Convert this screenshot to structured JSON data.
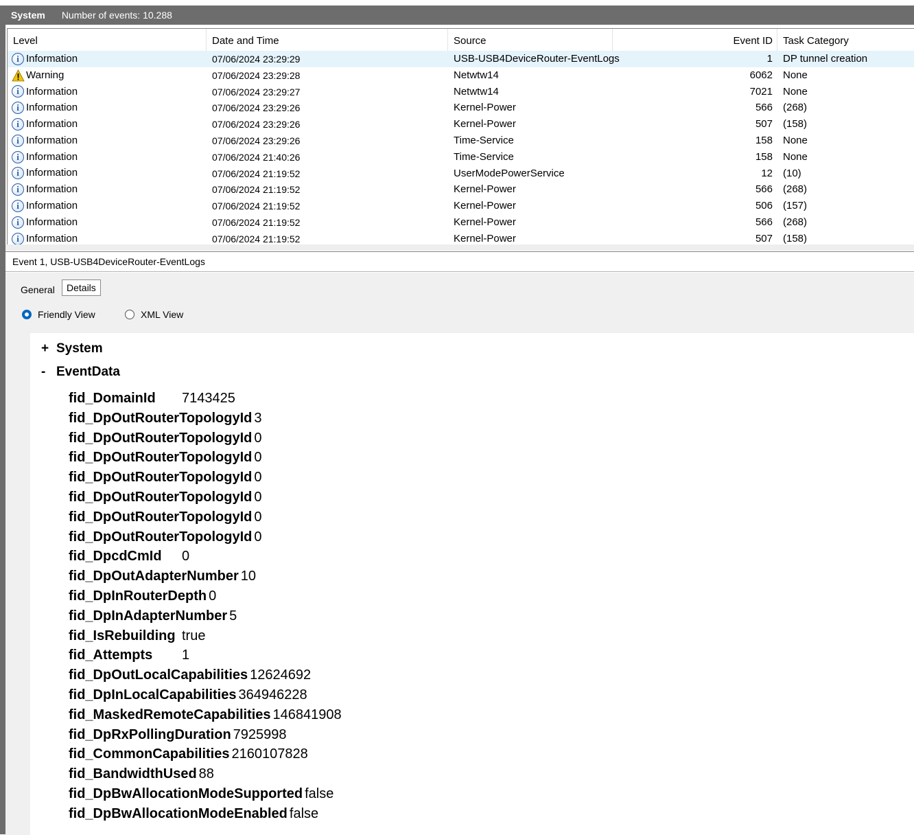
{
  "header": {
    "log_name": "System",
    "event_count": "Number of events: 10.288"
  },
  "columns": [
    "Level",
    "Date and Time",
    "Source",
    "Event ID",
    "Task Category"
  ],
  "events": [
    {
      "level": "Information",
      "icon": "info-icon",
      "datetime": "07/06/2024 23:29:29",
      "source": "USB-USB4DeviceRouter-EventLogs",
      "event_id": "1",
      "task": "DP tunnel creation",
      "selected": true
    },
    {
      "level": "Warning",
      "icon": "warning-icon",
      "datetime": "07/06/2024 23:29:28",
      "source": "Netwtw14",
      "event_id": "6062",
      "task": "None"
    },
    {
      "level": "Information",
      "icon": "info-icon",
      "datetime": "07/06/2024 23:29:27",
      "source": "Netwtw14",
      "event_id": "7021",
      "task": "None"
    },
    {
      "level": "Information",
      "icon": "info-icon",
      "datetime": "07/06/2024 23:29:26",
      "source": "Kernel-Power",
      "event_id": "566",
      "task": "(268)"
    },
    {
      "level": "Information",
      "icon": "info-icon",
      "datetime": "07/06/2024 23:29:26",
      "source": "Kernel-Power",
      "event_id": "507",
      "task": "(158)"
    },
    {
      "level": "Information",
      "icon": "info-icon",
      "datetime": "07/06/2024 23:29:26",
      "source": "Time-Service",
      "event_id": "158",
      "task": "None"
    },
    {
      "level": "Information",
      "icon": "info-icon",
      "datetime": "07/06/2024 21:40:26",
      "source": "Time-Service",
      "event_id": "158",
      "task": "None"
    },
    {
      "level": "Information",
      "icon": "info-icon",
      "datetime": "07/06/2024 21:19:52",
      "source": "UserModePowerService",
      "event_id": "12",
      "task": "(10)"
    },
    {
      "level": "Information",
      "icon": "info-icon",
      "datetime": "07/06/2024 21:19:52",
      "source": "Kernel-Power",
      "event_id": "566",
      "task": "(268)"
    },
    {
      "level": "Information",
      "icon": "info-icon",
      "datetime": "07/06/2024 21:19:52",
      "source": "Kernel-Power",
      "event_id": "506",
      "task": "(157)"
    },
    {
      "level": "Information",
      "icon": "info-icon",
      "datetime": "07/06/2024 21:19:52",
      "source": "Kernel-Power",
      "event_id": "566",
      "task": "(268)"
    },
    {
      "level": "Information",
      "icon": "info-icon",
      "datetime": "07/06/2024 21:19:52",
      "source": "Kernel-Power",
      "event_id": "507",
      "task": "(158)"
    }
  ],
  "detail": {
    "title": "Event 1, USB-USB4DeviceRouter-EventLogs",
    "tabs": {
      "general": "General",
      "details": "Details"
    },
    "active_tab": "Details",
    "views": {
      "friendly": "Friendly View",
      "xml": "XML View"
    },
    "selected_view": "Friendly View",
    "system_node": {
      "sign": "+",
      "label": "System"
    },
    "eventdata_node": {
      "sign": "-",
      "label": "EventData"
    },
    "fields": [
      {
        "name": "fid_DomainId",
        "value": "7143425"
      },
      {
        "name": "fid_DpOutRouterTopologyId",
        "value": "3"
      },
      {
        "name": "fid_DpOutRouterTopologyId",
        "value": "0"
      },
      {
        "name": "fid_DpOutRouterTopologyId",
        "value": "0"
      },
      {
        "name": "fid_DpOutRouterTopologyId",
        "value": "0"
      },
      {
        "name": "fid_DpOutRouterTopologyId",
        "value": "0"
      },
      {
        "name": "fid_DpOutRouterTopologyId",
        "value": "0"
      },
      {
        "name": "fid_DpOutRouterTopologyId",
        "value": "0"
      },
      {
        "name": "fid_DpcdCmId",
        "value": "0"
      },
      {
        "name": "fid_DpOutAdapterNumber",
        "value": "10"
      },
      {
        "name": "fid_DpInRouterDepth",
        "value": "0"
      },
      {
        "name": "fid_DpInAdapterNumber",
        "value": "5"
      },
      {
        "name": "fid_IsRebuilding",
        "value": "true"
      },
      {
        "name": "fid_Attempts",
        "value": "1"
      },
      {
        "name": "fid_DpOutLocalCapabilities",
        "value": "12624692"
      },
      {
        "name": "fid_DpInLocalCapabilities",
        "value": "364946228"
      },
      {
        "name": "fid_MaskedRemoteCapabilities",
        "value": "146841908"
      },
      {
        "name": "fid_DpRxPollingDuration",
        "value": "7925998"
      },
      {
        "name": "fid_CommonCapabilities",
        "value": "2160107828"
      },
      {
        "name": "fid_BandwidthUsed",
        "value": "88"
      },
      {
        "name": "fid_DpBwAllocationModeSupported",
        "value": "false"
      },
      {
        "name": "fid_DpBwAllocationModeEnabled",
        "value": "false"
      }
    ]
  }
}
